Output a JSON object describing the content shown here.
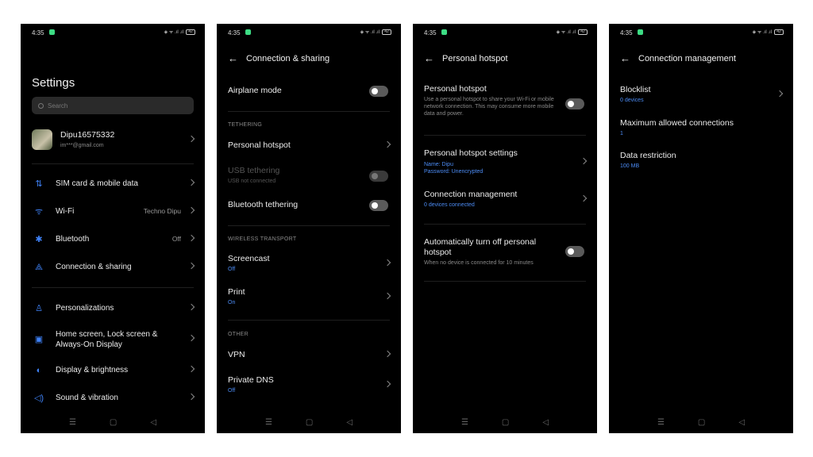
{
  "status": {
    "time": "4:35",
    "battery": "42"
  },
  "screen1": {
    "title": "Settings",
    "search_placeholder": "Search",
    "account": {
      "name": "Dipu16575332",
      "email": "im***@gmail.com"
    },
    "items": [
      {
        "label": "SIM card & mobile data",
        "value": "",
        "icon": "sim-icon"
      },
      {
        "label": "Wi-Fi",
        "value": "Techno Dipu",
        "icon": "wifi-icon"
      },
      {
        "label": "Bluetooth",
        "value": "Off",
        "icon": "bluetooth-icon"
      },
      {
        "label": "Connection & sharing",
        "value": "",
        "icon": "share-icon"
      },
      {
        "label": "Personalizations",
        "value": "",
        "icon": "personalize-icon"
      },
      {
        "label": "Home screen, Lock screen &",
        "label2": "Always-On Display",
        "value": "",
        "icon": "home-screen-icon"
      },
      {
        "label": "Display & brightness",
        "value": "",
        "icon": "brightness-icon"
      },
      {
        "label": "Sound & vibration",
        "value": "",
        "icon": "sound-icon"
      }
    ]
  },
  "screen2": {
    "title": "Connection & sharing",
    "airplane": "Airplane mode",
    "sec_tethering": "TETHERING",
    "hotspot": "Personal hotspot",
    "usb": "USB tethering",
    "usb_sub": "USB not connected",
    "bt_tether": "Bluetooth tethering",
    "sec_wireless": "WIRELESS TRANSPORT",
    "screencast": "Screencast",
    "screencast_sub": "Off",
    "print": "Print",
    "print_sub": "On",
    "sec_other": "OTHER",
    "vpn": "VPN",
    "dns": "Private DNS",
    "dns_sub": "Off"
  },
  "screen3": {
    "title": "Personal hotspot",
    "hotspot": "Personal hotspot",
    "hotspot_desc": "Use a personal hotspot to share your Wi-Fi or mobile network connection. This may consume more mobile data and power.",
    "settings": "Personal hotspot settings",
    "settings_name": "Name: Dipu",
    "settings_pw": "Password: Unencrypted",
    "conn_mgmt": "Connection management",
    "conn_sub": "0 devices connected",
    "auto_off": "Automatically turn off personal hotspot",
    "auto_off_sub": "When no device is connected for 10 minutes"
  },
  "screen4": {
    "title": "Connection management",
    "blocklist": "Blocklist",
    "blocklist_sub": "0 devices",
    "max_conn": "Maximum allowed connections",
    "max_conn_sub": "1",
    "data_restr": "Data restriction",
    "data_restr_sub": "100 MB"
  },
  "navbar": {
    "menu": "☰",
    "home": "▢",
    "back": "◁"
  }
}
